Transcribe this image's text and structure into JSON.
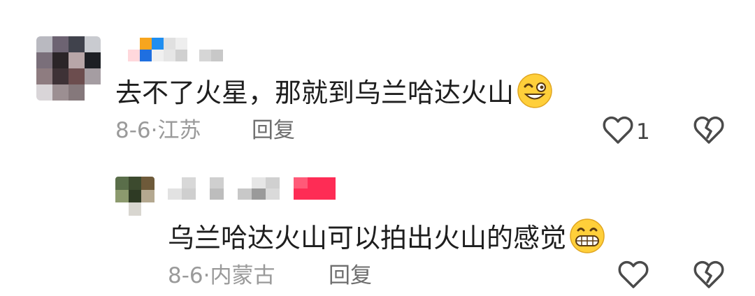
{
  "comments": [
    {
      "text": "去不了火星，那就到乌兰哈达火山",
      "emoji": "grinning-squinting-face-icon",
      "date": "8-6",
      "separator": "·",
      "location": "江苏",
      "reply_label": "回复",
      "like_count": "1"
    },
    {
      "text": "乌兰哈达火山可以拍出火山的感觉",
      "emoji": "grimacing-face-icon",
      "date": "8-6",
      "separator": "·",
      "location": "内蒙古",
      "reply_label": "回复",
      "like_count": ""
    }
  ],
  "colors": {
    "text": "#1e1e1e",
    "meta": "#9a9a9a",
    "reply": "#6e6e6e",
    "icon_stroke": "#4a4a4a",
    "background": "#ffffff"
  }
}
